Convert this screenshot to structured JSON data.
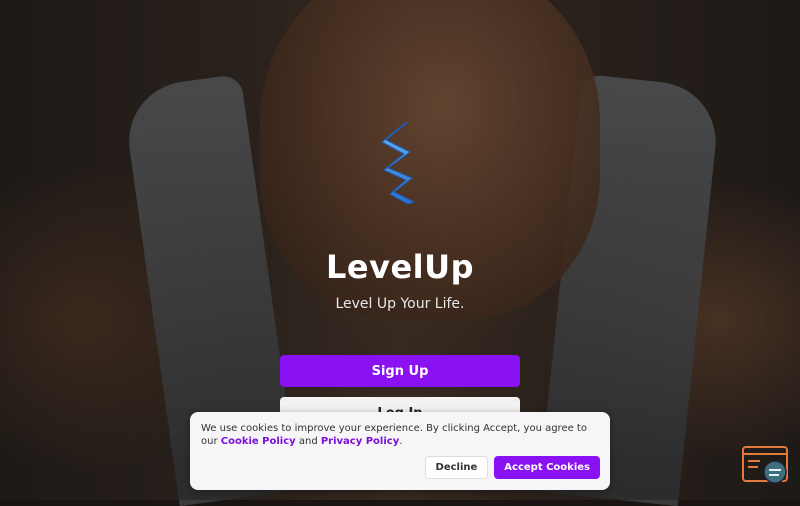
{
  "app": {
    "title": "LevelUp",
    "tagline": "Level Up Your Life.",
    "logo_icon": "lightning-zigzag-icon",
    "accent_color": "#8a12f2"
  },
  "auth": {
    "signup_label": "Sign Up",
    "login_label": "Log In"
  },
  "cookie_banner": {
    "text_before": "We use cookies to improve your experience. By clicking Accept, you agree to our ",
    "cookie_policy_label": "Cookie Policy",
    "and_text": " and ",
    "privacy_policy_label": "Privacy Policy",
    "text_after": ".",
    "decline_label": "Decline",
    "accept_label": "Accept Cookies"
  },
  "widget": {
    "icon": "chat-support-icon"
  }
}
